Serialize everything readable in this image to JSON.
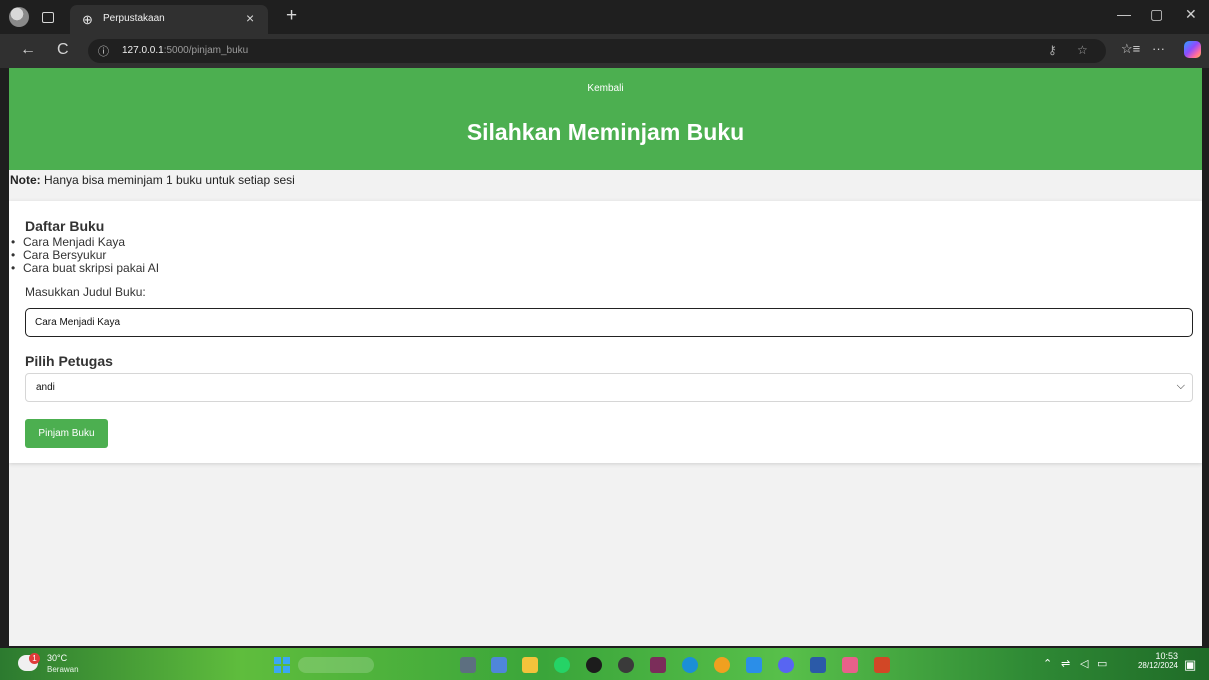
{
  "browser": {
    "tab_title": "Perpustakaan",
    "tab_close": "×",
    "new_tab": "+",
    "url_host": "127.0.0.1",
    "url_path": ":5000/pinjam_buku",
    "icons": {
      "info": "ⓘ",
      "back": "←",
      "reload": "C",
      "key": "⚷",
      "favorite": "☆",
      "collections": "☆≡",
      "more": "···",
      "minimize": "—",
      "restore": "▢",
      "close": "✕",
      "globe": "⊕"
    }
  },
  "page": {
    "back_link": "Kembali",
    "title": "Silahkan Meminjam Buku",
    "note_label": "Note:",
    "note_text": " Hanya bisa meminjam 1 buku untuk setiap sesi",
    "book_list_heading": "Daftar Buku",
    "books": [
      "Cara Menjadi Kaya",
      "Cara Bersyukur",
      "Cara buat skripsi pakai AI"
    ],
    "title_field_label": "Masukkan Judul Buku:",
    "title_field_value": "Cara Menjadi Kaya",
    "staff_heading": "Pilih Petugas",
    "staff_selected": "andi",
    "submit_label": "Pinjam Buku",
    "accent_color": "#4caf50"
  },
  "taskbar": {
    "weather_temp": "30°C",
    "weather_condition": "Berawan",
    "weather_badge": "1",
    "time": "10:53",
    "date": "28/12/2024"
  }
}
